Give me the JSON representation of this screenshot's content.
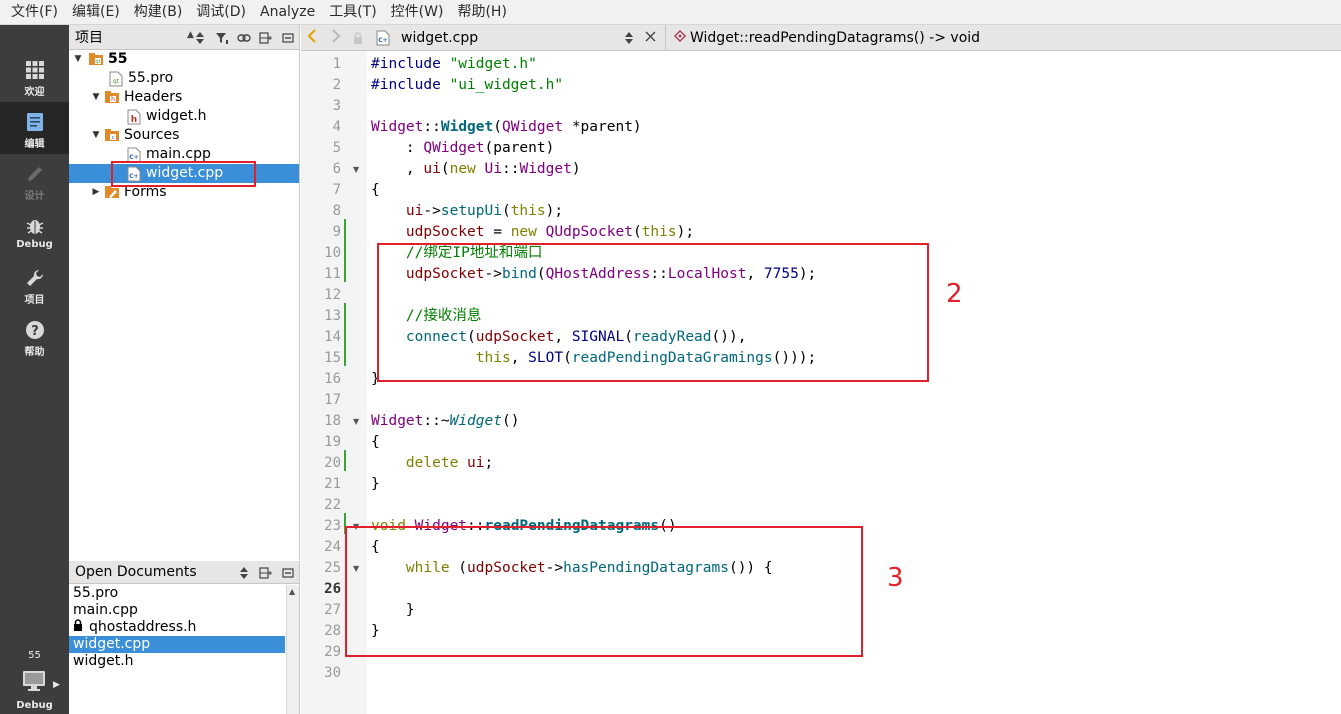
{
  "menu": [
    "文件(F)",
    "编辑(E)",
    "构建(B)",
    "调试(D)",
    "Analyze",
    "工具(T)",
    "控件(W)",
    "帮助(H)"
  ],
  "modes": [
    {
      "label": "欢迎",
      "icon": "grid-icon"
    },
    {
      "label": "编辑",
      "icon": "document-edit-icon"
    },
    {
      "label": "设计",
      "icon": "pencil-icon"
    },
    {
      "label": "Debug",
      "icon": "bug-icon"
    },
    {
      "label": "项目",
      "icon": "wrench-icon"
    },
    {
      "label": "帮助",
      "icon": "help-icon"
    }
  ],
  "target": {
    "name": "55",
    "label": "Debug"
  },
  "project_panel": {
    "title": "项目",
    "tree": [
      {
        "label": "55",
        "bold": true,
        "icon": "project-icon"
      },
      {
        "label": "55.pro",
        "icon": "pro-file-icon"
      },
      {
        "label": "Headers",
        "icon": "folder-icon"
      },
      {
        "label": "widget.h",
        "icon": "header-file-icon"
      },
      {
        "label": "Sources",
        "icon": "folder-icon"
      },
      {
        "label": "main.cpp",
        "icon": "cpp-file-icon"
      },
      {
        "label": "widget.cpp",
        "icon": "cpp-file-icon",
        "selected": true
      },
      {
        "label": "Forms",
        "icon": "folder-icon"
      }
    ]
  },
  "open_documents": {
    "title": "Open Documents",
    "items": [
      {
        "label": "55.pro"
      },
      {
        "label": "main.cpp"
      },
      {
        "label": "qhostaddress.h",
        "locked": true
      },
      {
        "label": "widget.cpp",
        "selected": true
      },
      {
        "label": "widget.h"
      }
    ]
  },
  "editor_toolbar": {
    "file_name": "widget.cpp",
    "function_name": "Widget::readPendingDatagrams() -> void"
  },
  "editor": {
    "current_line": 26,
    "lines": [
      [
        [
          "#include ",
          "pre"
        ],
        [
          "\"widget.h\"",
          "str"
        ]
      ],
      [
        [
          "#include ",
          "pre"
        ],
        [
          "\"ui_widget.h\"",
          "str"
        ]
      ],
      [],
      [
        [
          "Widget",
          "cls"
        ],
        [
          "::",
          ""
        ],
        [
          "Widget",
          "fnb"
        ],
        [
          "(",
          ""
        ],
        [
          "QWidget",
          "cls"
        ],
        [
          " *parent)",
          ""
        ]
      ],
      [
        [
          "    : ",
          ""
        ],
        [
          "QWidget",
          "cls"
        ],
        [
          "(parent)",
          ""
        ]
      ],
      [
        [
          "    , ",
          ""
        ],
        [
          "ui",
          "mem"
        ],
        [
          "(",
          ""
        ],
        [
          "new",
          "kw"
        ],
        [
          " ",
          ""
        ],
        [
          "Ui",
          "cls"
        ],
        [
          "::",
          ""
        ],
        [
          "Widget",
          "cls"
        ],
        [
          ")",
          ""
        ]
      ],
      [
        [
          "{",
          ""
        ]
      ],
      [
        [
          "    ",
          ""
        ],
        [
          "ui",
          "mem"
        ],
        [
          "->",
          ""
        ],
        [
          "setupUi",
          "fn"
        ],
        [
          "(",
          ""
        ],
        [
          "this",
          "kw"
        ],
        [
          ");",
          ""
        ]
      ],
      [
        [
          "    ",
          ""
        ],
        [
          "udpSocket",
          "mem"
        ],
        [
          " = ",
          ""
        ],
        [
          "new",
          "kw"
        ],
        [
          " ",
          ""
        ],
        [
          "QUdpSocket",
          "cls"
        ],
        [
          "(",
          ""
        ],
        [
          "this",
          "kw"
        ],
        [
          ");",
          ""
        ]
      ],
      [
        [
          "    ",
          ""
        ],
        [
          "//绑定IP地址和端口",
          "cmt"
        ]
      ],
      [
        [
          "    ",
          ""
        ],
        [
          "udpSocket",
          "mem"
        ],
        [
          "->",
          ""
        ],
        [
          "bind",
          "fn"
        ],
        [
          "(",
          ""
        ],
        [
          "QHostAddress",
          "cls"
        ],
        [
          "::",
          ""
        ],
        [
          "LocalHost",
          "enum"
        ],
        [
          ", ",
          ""
        ],
        [
          "7755",
          "num"
        ],
        [
          ");",
          ""
        ]
      ],
      [],
      [
        [
          "    ",
          ""
        ],
        [
          "//接收消息",
          "cmt"
        ]
      ],
      [
        [
          "    ",
          ""
        ],
        [
          "connect",
          "fn"
        ],
        [
          "(",
          ""
        ],
        [
          "udpSocket",
          "mem"
        ],
        [
          ", ",
          ""
        ],
        [
          "SIGNAL",
          "mac"
        ],
        [
          "(",
          ""
        ],
        [
          "readyRead",
          "fn"
        ],
        [
          "()),",
          ""
        ]
      ],
      [
        [
          "            ",
          ""
        ],
        [
          "this",
          "kw"
        ],
        [
          ", ",
          ""
        ],
        [
          "SLOT",
          "mac"
        ],
        [
          "(",
          ""
        ],
        [
          "readPendingDataGramings",
          "fn"
        ],
        [
          "()));",
          ""
        ]
      ],
      [
        [
          "}",
          ""
        ]
      ],
      [],
      [
        [
          "Widget",
          "cls"
        ],
        [
          "::~",
          ""
        ],
        [
          "Widget",
          "it"
        ],
        [
          "()",
          ""
        ]
      ],
      [
        [
          "{",
          ""
        ]
      ],
      [
        [
          "    ",
          ""
        ],
        [
          "delete",
          "kw"
        ],
        [
          " ",
          ""
        ],
        [
          "ui",
          "mem"
        ],
        [
          ";",
          ""
        ]
      ],
      [
        [
          "}",
          ""
        ]
      ],
      [],
      [
        [
          "void",
          "kw"
        ],
        [
          " ",
          ""
        ],
        [
          "Widget",
          "cls"
        ],
        [
          "::",
          ""
        ],
        [
          "readPendingDatagrams",
          "fnb"
        ],
        [
          "()",
          ""
        ]
      ],
      [
        [
          "{",
          ""
        ]
      ],
      [
        [
          "    ",
          ""
        ],
        [
          "while",
          "kw"
        ],
        [
          " (",
          ""
        ],
        [
          "udpSocket",
          "mem"
        ],
        [
          "->",
          ""
        ],
        [
          "hasPendingDatagrams",
          "fn"
        ],
        [
          "()) {",
          ""
        ]
      ],
      [],
      [
        [
          "    }",
          ""
        ]
      ],
      [
        [
          "}",
          ""
        ]
      ],
      [],
      []
    ]
  },
  "annotations": {
    "label_2": "2",
    "label_3": "3"
  },
  "colors": {
    "annotation": "#e0202a",
    "selection": "#3b8fd9",
    "sidebar": "#3d3d3d"
  }
}
